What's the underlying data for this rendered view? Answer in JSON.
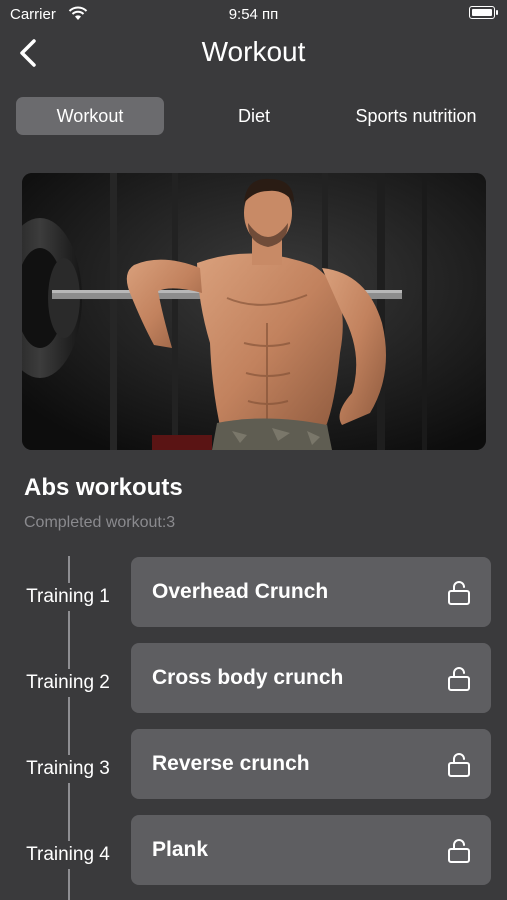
{
  "status_bar": {
    "carrier": "Carrier",
    "time": "9:54 пп"
  },
  "nav": {
    "title": "Workout"
  },
  "tabs": [
    {
      "label": "Workout",
      "active": true
    },
    {
      "label": "Diet",
      "active": false
    },
    {
      "label": "Sports nutrition",
      "active": false
    }
  ],
  "section": {
    "title": "Abs workouts",
    "completed": "Completed workout:3"
  },
  "trainings": [
    {
      "day": "Training 1",
      "name": "Overhead Crunch",
      "icon": "unlock-icon"
    },
    {
      "day": "Training 2",
      "name": "Cross body crunch",
      "icon": "unlock-icon"
    },
    {
      "day": "Training 3",
      "name": "Reverse crunch",
      "icon": "unlock-icon"
    },
    {
      "day": "Training 4",
      "name": "Plank",
      "icon": "unlock-icon"
    }
  ],
  "colors": {
    "background": "#3a3a3c",
    "active_tab": "#6b6b6e",
    "card": "#5e5e61",
    "muted_text": "#8a8a8e"
  }
}
